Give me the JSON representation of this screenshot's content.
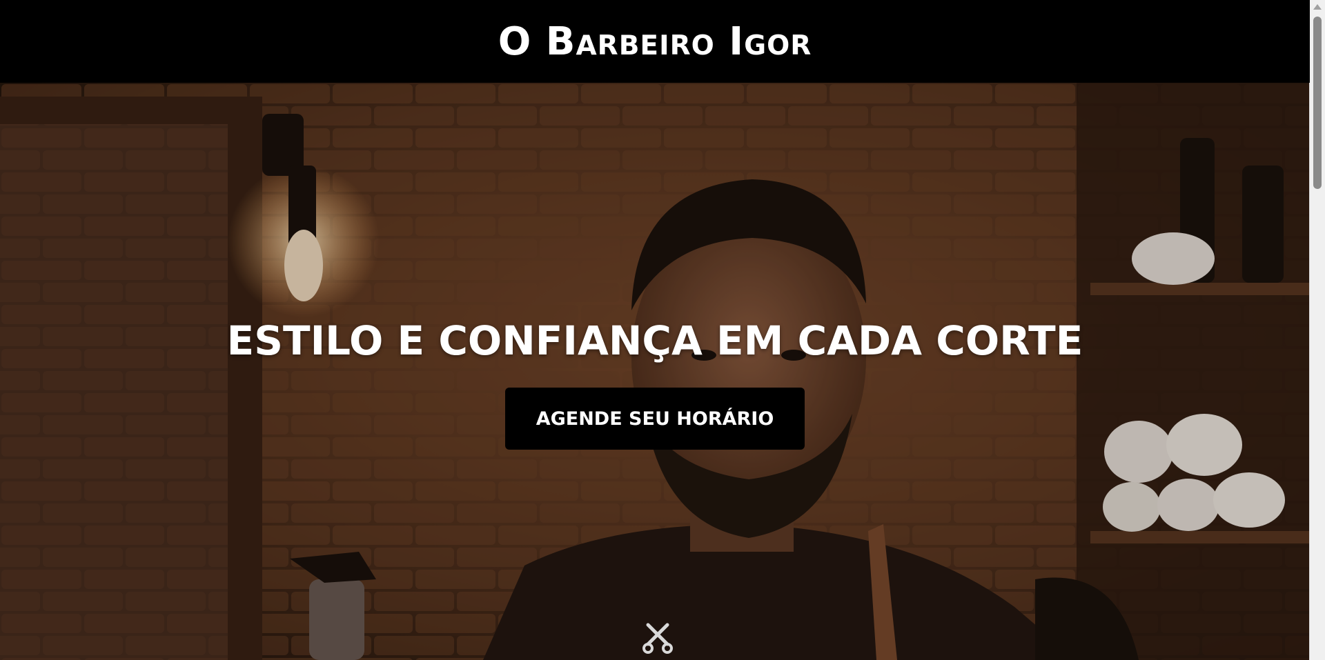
{
  "header": {
    "title": "O Barbeiro Igor"
  },
  "hero": {
    "heading": "ESTILO E CONFIANÇA EM CADA CORTE",
    "cta_label": "AGENDE SEU HORÁRIO",
    "scroll_icon": "scissors-icon"
  },
  "colors": {
    "header_bg": "#000000",
    "button_bg": "#000000",
    "text": "#ffffff",
    "hero_tone": "#5a3620"
  }
}
